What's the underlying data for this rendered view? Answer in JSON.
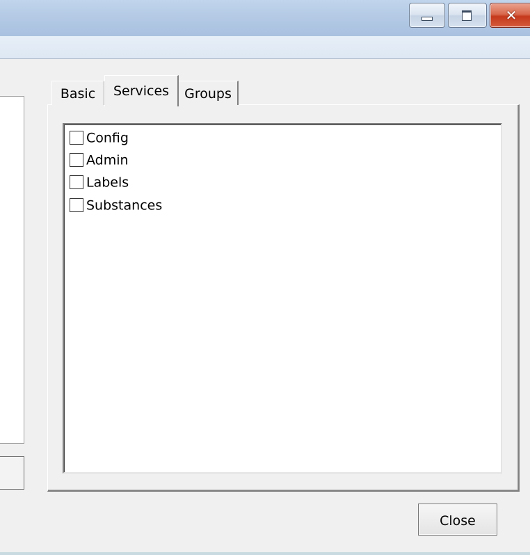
{
  "window": {
    "caption_buttons": [
      {
        "name": "minimize",
        "icon": "minimize-icon"
      },
      {
        "name": "maximize",
        "icon": "maximize-icon"
      },
      {
        "name": "close",
        "icon": "close-icon",
        "glyph": "✕"
      }
    ]
  },
  "tabs": [
    {
      "label": "Basic",
      "selected": false
    },
    {
      "label": "Services",
      "selected": true
    },
    {
      "label": "Groups",
      "selected": false
    }
  ],
  "services": {
    "items": [
      {
        "label": "Config",
        "checked": false
      },
      {
        "label": "Admin",
        "checked": false
      },
      {
        "label": "Labels",
        "checked": false
      },
      {
        "label": "Substances",
        "checked": false
      }
    ]
  },
  "footer": {
    "close_label": "Close"
  },
  "colors": {
    "titlebar": "#b4cae5",
    "close_caption": "#c5391c",
    "face": "#f0f0f0"
  }
}
